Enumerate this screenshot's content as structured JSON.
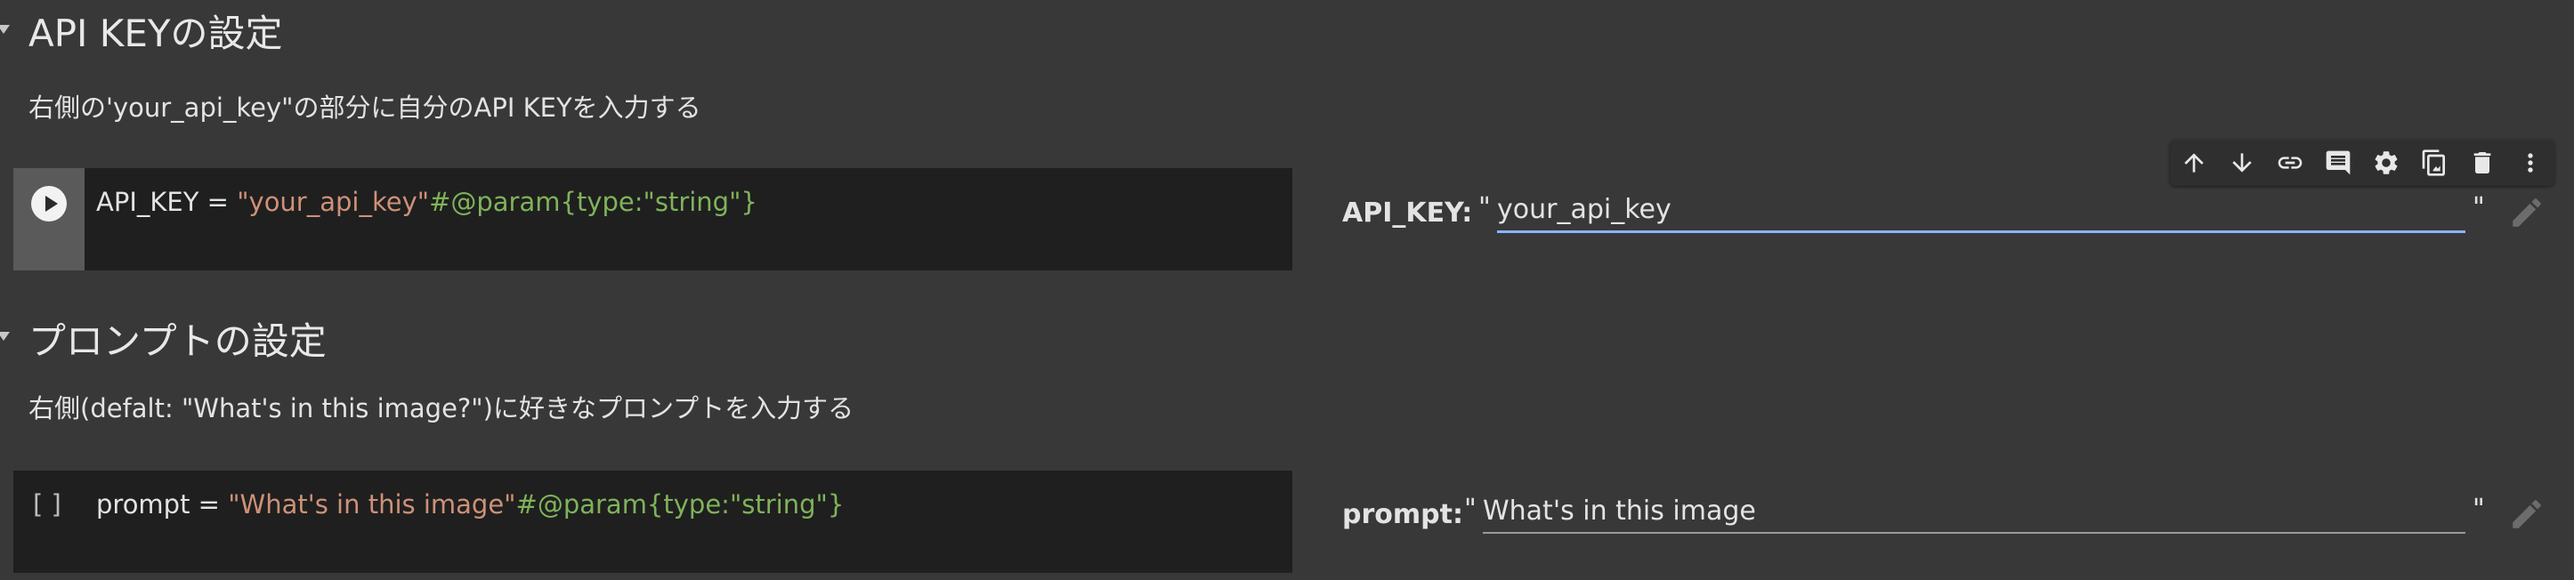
{
  "sections": [
    {
      "heading": "API KEYの設定",
      "description": "右側の'your_api_key\"の部分に自分のAPI KEYを入力する",
      "code": {
        "var": "API_KEY",
        "op": " = ",
        "string": "\"your_api_key\"",
        "comment": "#@param{type:\"string\"}"
      },
      "form": {
        "label": "API_KEY:",
        "open_quote": "\"",
        "value": "your_api_key",
        "close_quote": "\""
      },
      "gutter": "run"
    },
    {
      "heading": "プロンプトの設定",
      "description": "右側(defalt: \"What's in this image?\")に好きなプロンプトを入力する",
      "code": {
        "var": "prompt",
        "op": " = ",
        "string": "\"What's in this image\"",
        "comment": "#@param{type:\"string\"}"
      },
      "form": {
        "label": "prompt:",
        "open_quote": "\"",
        "value": "What's in this image",
        "close_quote": "\""
      },
      "gutter": "[ ]"
    }
  ],
  "toolbar": {
    "icons": [
      "arrow-up-icon",
      "arrow-down-icon",
      "link-icon",
      "comment-icon",
      "gear-icon",
      "mirror-cell-icon",
      "trash-icon",
      "more-vert-icon"
    ]
  },
  "colors": {
    "background": "#383838",
    "code_background": "#1f1f1f",
    "string": "#ce9178",
    "comment": "#7fb35a",
    "focus_underline": "#8ab4f8"
  }
}
